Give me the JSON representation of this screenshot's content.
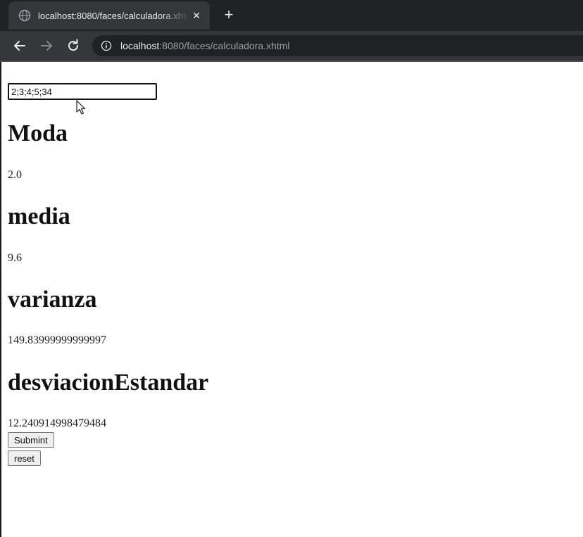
{
  "browser": {
    "tab_title": "localhost:8080/faces/calculadora.xhtml",
    "close_glyph": "✕",
    "newtab_glyph": "+",
    "url_host": "localhost",
    "url_rest": ":8080/faces/calculadora.xhtml",
    "colors": {
      "frame": "#202124",
      "toolbar": "#35363a",
      "text": "#e8eaed"
    }
  },
  "form": {
    "input_value": "2;3;4;5;34",
    "sections": [
      {
        "heading": "Moda",
        "value": "2.0"
      },
      {
        "heading": "media",
        "value": "9.6"
      },
      {
        "heading": "varianza",
        "value": "149.83999999999997"
      },
      {
        "heading": "desviacionEstandar",
        "value": "12.240914998479484"
      }
    ],
    "submit_label": "Submint",
    "reset_label": "reset"
  },
  "icons": {
    "tab_favicon": "globe-icon",
    "back": "back-arrow-icon",
    "forward": "forward-arrow-icon",
    "reload": "reload-icon",
    "site_info": "info-icon",
    "pointer": "mouse-pointer-icon"
  }
}
